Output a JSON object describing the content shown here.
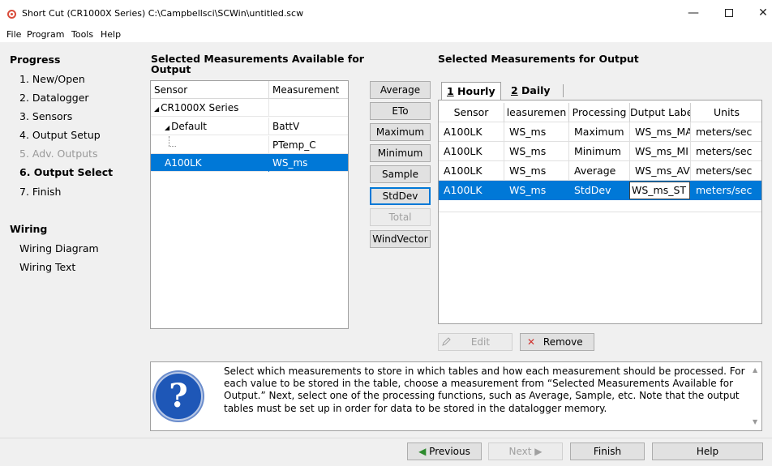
{
  "window": {
    "title": "Short Cut (CR1000X Series) C:\\Campbellsci\\SCWin\\untitled.scw",
    "minimize": "—",
    "close": "✕"
  },
  "menu": [
    "File",
    "Program",
    "Tools",
    "Help"
  ],
  "nav": {
    "progress_header": "Progress",
    "progress_items": [
      "1. New/Open",
      "2. Datalogger",
      "3. Sensors",
      "4. Output Setup",
      "5. Adv. Outputs",
      "6. Output Select",
      "7. Finish"
    ],
    "current_item": "6. Output Select",
    "disabled_item": "5. Adv. Outputs",
    "wiring_header": "Wiring",
    "wiring_items": [
      "Wiring Diagram",
      "Wiring Text"
    ]
  },
  "available": {
    "title": "Selected Measurements Available for Output",
    "col_sensor": "Sensor",
    "col_measurement": "Measurement",
    "rows": [
      {
        "sensor": "CR1000X Series",
        "measurement": "",
        "expander": "◢"
      },
      {
        "sensor": "Default",
        "measurement": "BattV",
        "expander": "◢"
      },
      {
        "sensor": "",
        "measurement": "PTemp_C"
      },
      {
        "sensor": "A100LK",
        "measurement": "WS_ms",
        "selected": true
      }
    ]
  },
  "processing": {
    "buttons": [
      "Average",
      "ETo",
      "Maximum",
      "Minimum",
      "Sample",
      "StdDev",
      "Total",
      "WindVector"
    ],
    "focused": "StdDev",
    "disabled": "Total"
  },
  "output": {
    "title": "Selected Measurements for Output",
    "tabs": [
      {
        "key": "1",
        "label": " Hourly"
      },
      {
        "key": "2",
        "label": " Daily"
      }
    ],
    "columns": [
      "Sensor",
      "leasuremen",
      "Processing",
      "Dutput Labe",
      "Units"
    ],
    "rows": [
      {
        "sensor": "A100LK",
        "measurement": "WS_ms",
        "processing": "Maximum",
        "label": "WS_ms_MA",
        "units": "meters/sec"
      },
      {
        "sensor": "A100LK",
        "measurement": "WS_ms",
        "processing": "Minimum",
        "label": "WS_ms_MI",
        "units": "meters/sec"
      },
      {
        "sensor": "A100LK",
        "measurement": "WS_ms",
        "processing": "Average",
        "label": "WS_ms_AV",
        "units": "meters/sec"
      },
      {
        "sensor": "A100LK",
        "measurement": "WS_ms",
        "processing": "StdDev",
        "label": "WS_ms_ST",
        "units": "meters/sec",
        "selected": true
      }
    ],
    "edit_label": "Edit",
    "remove_label": "Remove"
  },
  "help": {
    "text": "Select which measurements to store in which tables and how each measurement should be processed. For each value to be stored in the table, choose a measurement from “Selected Measurements Available for Output.” Next, select one of the processing functions, such as Average, Sample, etc. Note that the output tables must be set up in order for data to be stored in the datalogger memory."
  },
  "footer": {
    "previous": "Previous",
    "next": "Next",
    "finish": "Finish",
    "help": "Help"
  },
  "colors": {
    "selection": "#0078d7",
    "remove_icon": "#d0312d"
  },
  "icons": [
    "app-icon",
    "expand-icon",
    "edit-icon",
    "remove-icon",
    "help-question-icon",
    "arrow-left-icon",
    "arrow-right-icon"
  ]
}
